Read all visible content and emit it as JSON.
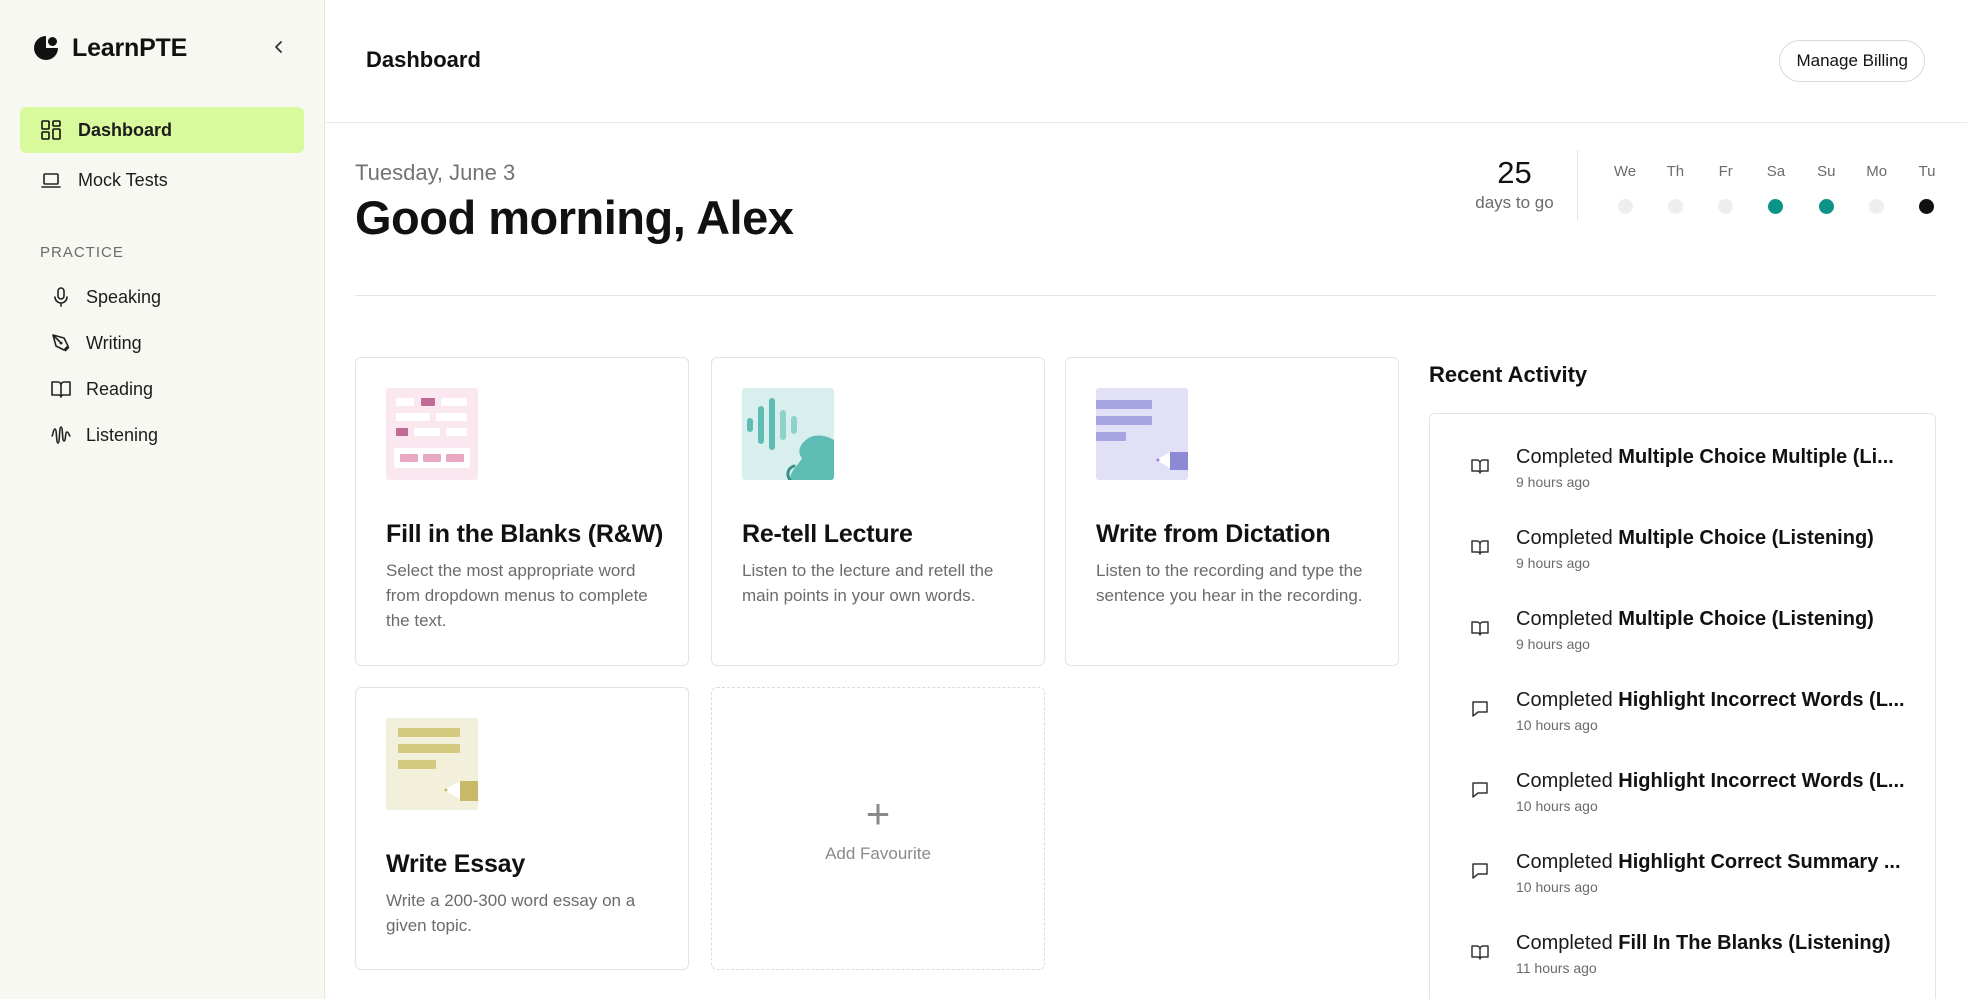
{
  "brand": {
    "name": "LearnPTE"
  },
  "sidebar": {
    "nav": [
      {
        "label": "Dashboard",
        "icon": "dashboard-grid-icon",
        "active": true
      },
      {
        "label": "Mock Tests",
        "icon": "laptop-icon",
        "active": false
      }
    ],
    "practice_label": "PRACTICE",
    "practice": [
      {
        "label": "Speaking",
        "icon": "microphone-icon"
      },
      {
        "label": "Writing",
        "icon": "pen-icon"
      },
      {
        "label": "Reading",
        "icon": "book-icon"
      },
      {
        "label": "Listening",
        "icon": "waveform-icon"
      }
    ]
  },
  "header": {
    "title": "Dashboard",
    "billing_label": "Manage Billing"
  },
  "greeting": {
    "date": "Tuesday, June 3",
    "message": "Good morning, Alex",
    "countdown_value": "25",
    "countdown_label": "days to go"
  },
  "week": [
    {
      "label": "We",
      "status": "inactive"
    },
    {
      "label": "Th",
      "status": "inactive"
    },
    {
      "label": "Fr",
      "status": "inactive"
    },
    {
      "label": "Sa",
      "status": "done"
    },
    {
      "label": "Su",
      "status": "done"
    },
    {
      "label": "Mo",
      "status": "inactive"
    },
    {
      "label": "Tu",
      "status": "today"
    }
  ],
  "colors": {
    "accent": "#d9f99d",
    "done_dot": "#0d9488",
    "today_dot": "#111111",
    "inactive_dot": "#eeeeee"
  },
  "cards": [
    {
      "title": "Fill in the Blanks (R&W)",
      "description": "Select the most appropriate word from dropdown menus to complete the text.",
      "thumb": "fill-blanks"
    },
    {
      "title": "Re-tell Lecture",
      "description": "Listen to the lecture and retell the main points in your own words.",
      "thumb": "retell-lecture"
    },
    {
      "title": "Write from Dictation",
      "description": "Listen to the recording and type the sentence you hear in the recording.",
      "thumb": "write-dictation"
    },
    {
      "title": "Write Essay",
      "description": "Write a 200-300 word essay on a given topic.",
      "thumb": "write-essay"
    }
  ],
  "add_favourite": {
    "label": "Add Favourite"
  },
  "recent_activity": {
    "title": "Recent Activity",
    "items": [
      {
        "prefix": "Completed",
        "name": "Multiple Choice Multiple (Li...",
        "time": "9 hours ago",
        "icon": "book-icon"
      },
      {
        "prefix": "Completed",
        "name": "Multiple Choice (Listening)",
        "time": "9 hours ago",
        "icon": "book-icon"
      },
      {
        "prefix": "Completed",
        "name": "Multiple Choice (Listening)",
        "time": "9 hours ago",
        "icon": "book-icon"
      },
      {
        "prefix": "Completed",
        "name": "Highlight Incorrect Words (L...",
        "time": "10 hours ago",
        "icon": "chat-icon"
      },
      {
        "prefix": "Completed",
        "name": "Highlight Incorrect Words (L...",
        "time": "10 hours ago",
        "icon": "chat-icon"
      },
      {
        "prefix": "Completed",
        "name": "Highlight Correct Summary ...",
        "time": "10 hours ago",
        "icon": "chat-icon"
      },
      {
        "prefix": "Completed",
        "name": "Fill In The Blanks (Listening)",
        "time": "11 hours ago",
        "icon": "book-icon"
      }
    ]
  }
}
